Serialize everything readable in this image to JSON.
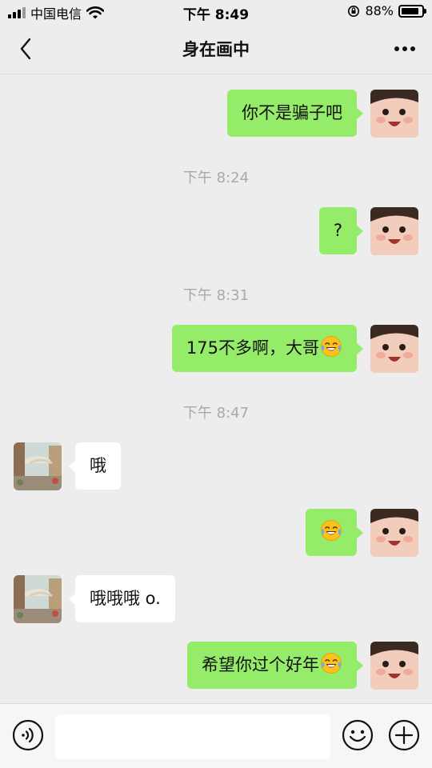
{
  "status_bar": {
    "carrier": "中国电信",
    "time": "下午 8:49",
    "battery_text": "88%",
    "battery_level": 0.88
  },
  "header": {
    "back_icon": "chevron-left-icon",
    "title": "身在画中",
    "more_icon": "more-dots-icon"
  },
  "messages": [
    {
      "sender": "me",
      "text": "你不是骗子吧"
    },
    {
      "type": "timestamp",
      "text": "下午 8:24"
    },
    {
      "sender": "me",
      "text": "?"
    },
    {
      "type": "timestamp",
      "text": "下午 8:31"
    },
    {
      "sender": "me",
      "text": "175不多啊，大哥",
      "emoji": "laugh-cry-emoji"
    },
    {
      "type": "timestamp",
      "text": "下午 8:47"
    },
    {
      "sender": "other",
      "text": "哦"
    },
    {
      "sender": "me",
      "text": "",
      "emoji": "laugh-cry-emoji"
    },
    {
      "sender": "other",
      "text": "哦哦哦 o."
    },
    {
      "sender": "me",
      "text": "希望你过个好年",
      "emoji": "laugh-cry-emoji"
    }
  ],
  "input_bar": {
    "voice_icon": "voice-icon",
    "text_value": "",
    "emoji_icon": "smiley-icon",
    "plus_icon": "plus-icon"
  },
  "colors": {
    "background": "#ededed",
    "my_bubble": "#95ec69",
    "other_bubble": "#ffffff",
    "timestamp": "#a9a9a9"
  }
}
